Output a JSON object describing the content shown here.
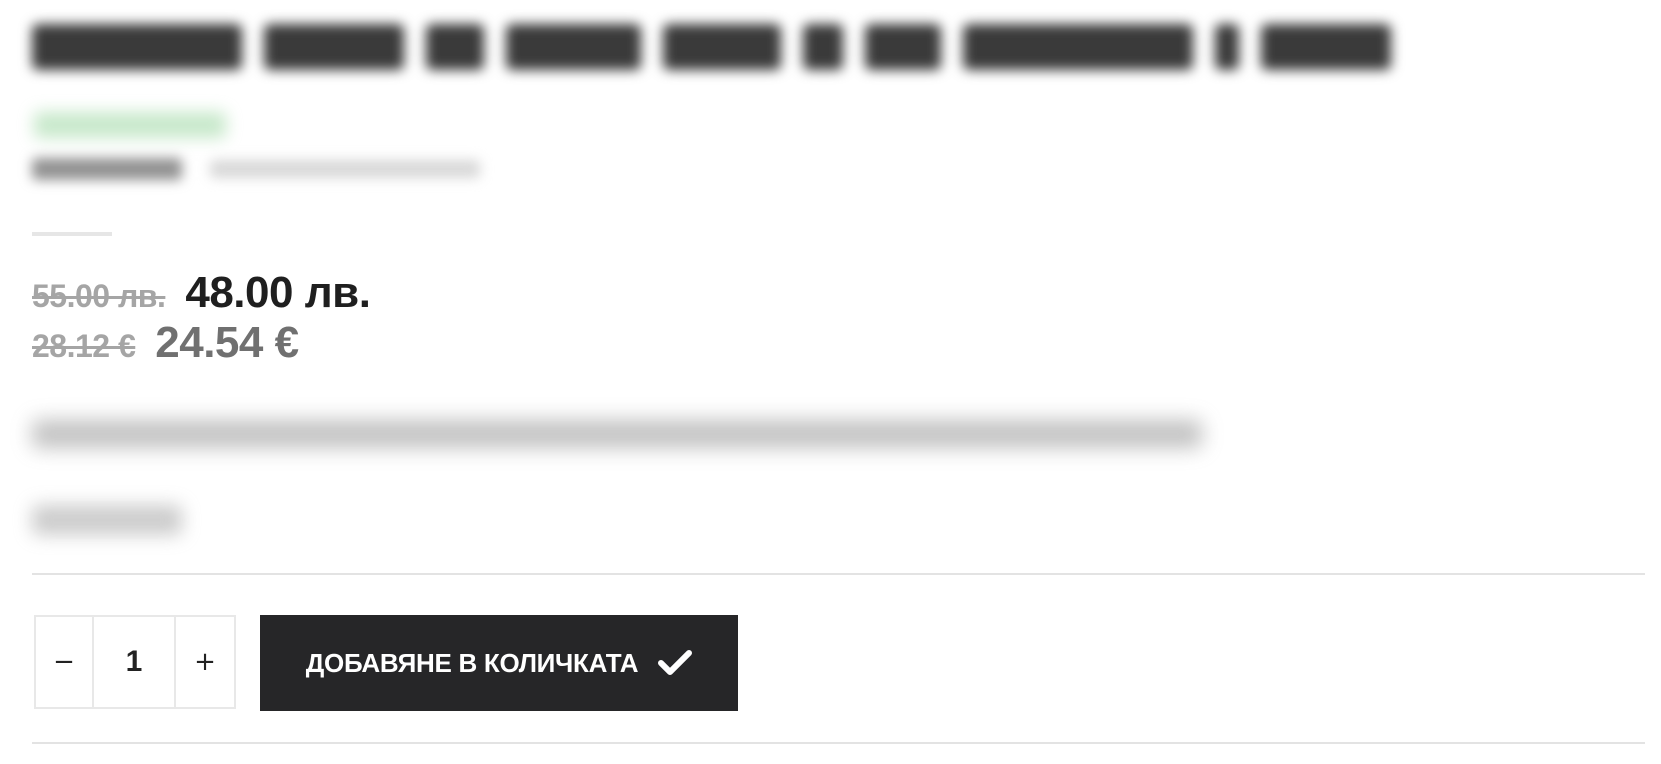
{
  "product": {
    "price_bgn": {
      "old": "55.00 лв.",
      "new": "48.00 лв."
    },
    "price_eur": {
      "old": "28.12 €",
      "new": "24.54 €"
    }
  },
  "cart": {
    "quantity": "1",
    "minus_label": "−",
    "plus_label": "+",
    "add_button_label": "ДОБАВЯНЕ В КОЛИЧКАТА",
    "add_button_icon": "checkmark-icon"
  },
  "colors": {
    "button_bg": "#262628",
    "old_price": "#a5a5a5",
    "new_price_bgn": "#1f1f1f",
    "new_price_eur": "#707070"
  }
}
